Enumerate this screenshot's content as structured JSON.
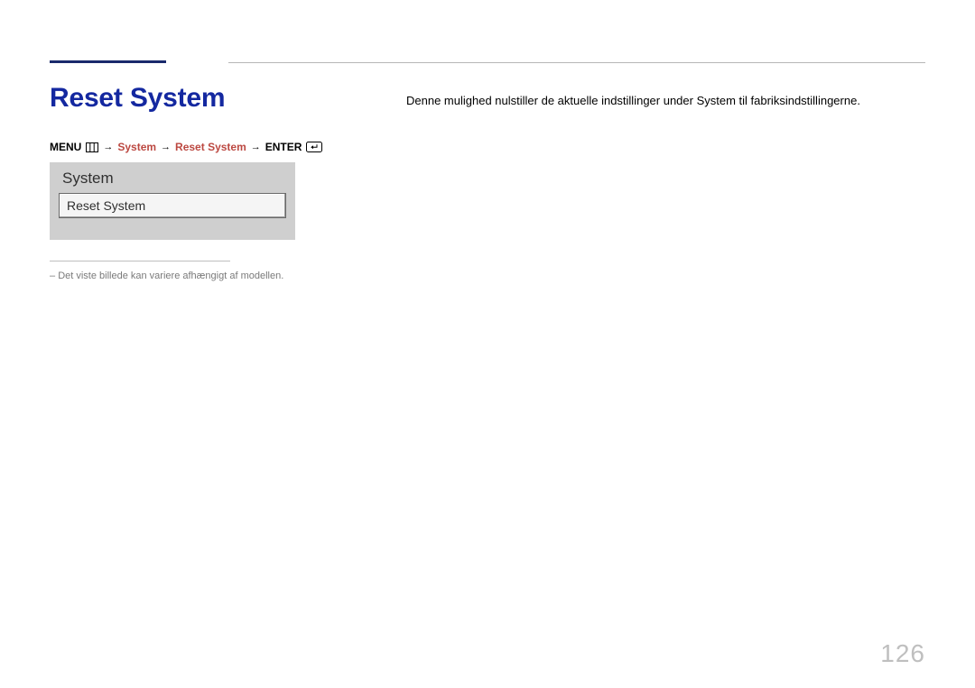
{
  "heading": "Reset System",
  "breadcrumb": {
    "menu_label": "MENU",
    "system": "System",
    "reset_system": "Reset System",
    "enter_label": "ENTER"
  },
  "menu_panel": {
    "title": "System",
    "items": [
      "Reset System"
    ]
  },
  "footnote": "Det viste billede kan variere afhængigt af modellen.",
  "body_text": "Denne mulighed nulstiller de aktuelle indstillinger under System til fabriksindstillingerne.",
  "page_number": "126"
}
